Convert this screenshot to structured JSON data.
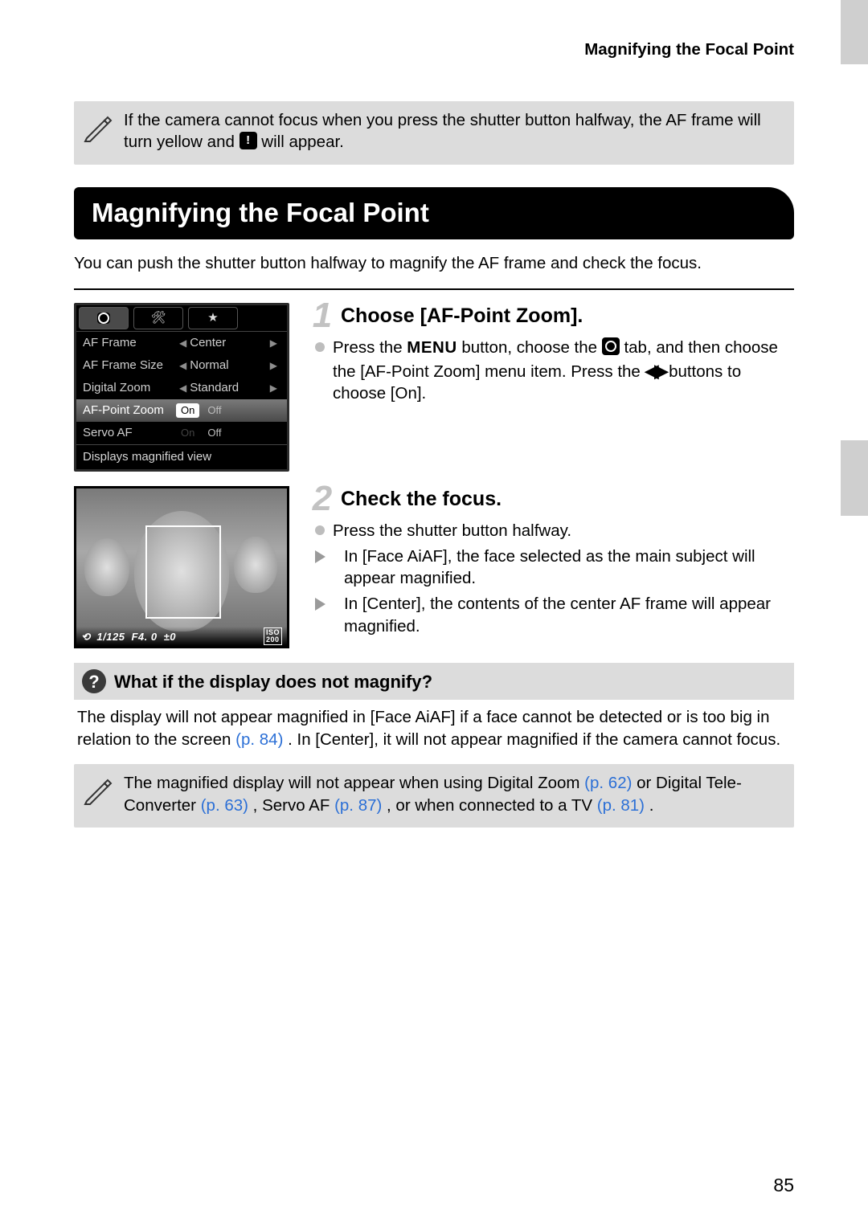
{
  "running_head": "Magnifying the Focal Point",
  "note_top": {
    "before_icon": "If the camera cannot focus when you press the shutter button halfway, the AF frame will turn yellow and ",
    "after_icon": " will appear."
  },
  "section_title": "Magnifying the Focal Point",
  "intro": "You can push the shutter button halfway to magnify the AF frame and check the focus.",
  "menu_mock": {
    "rows": {
      "af_frame": {
        "k": "AF Frame",
        "v": "Center"
      },
      "af_frame_size": {
        "k": "AF Frame Size",
        "v": "Normal"
      },
      "digital_zoom": {
        "k": "Digital Zoom",
        "v": "Standard"
      },
      "af_point_zoom": {
        "k": "AF-Point Zoom",
        "on": "On",
        "off": "Off"
      },
      "servo_af": {
        "k": "Servo AF",
        "on": "On",
        "off": "Off"
      }
    },
    "footer": "Displays magnified view"
  },
  "photo_mock": {
    "shutter": "1/125",
    "aperture": "F4. 0",
    "ev": "±0",
    "iso_top": "ISO",
    "iso_bottom": "200"
  },
  "step1": {
    "num": "1",
    "title": "Choose [AF-Point Zoom].",
    "bullet_a": "Press the ",
    "menu_word": "MENU",
    "bullet_b": " button, choose the ",
    "bullet_c": " tab, and then choose the [AF-Point Zoom] menu item. Press the ",
    "bullet_d": " buttons to choose [On]."
  },
  "step2": {
    "num": "2",
    "title": "Check the focus.",
    "line1": "Press the shutter button halfway.",
    "line2": "In [Face AiAF], the face selected as the main subject will appear magnified.",
    "line3": "In [Center], the contents of the center AF frame will appear magnified."
  },
  "question": {
    "title": "What if the display does not magnify?",
    "body_a": "The display will not appear magnified in [Face AiAF] if a face cannot be detected or is too big in relation to the screen ",
    "link_a": "(p. 84)",
    "body_b": ". In [Center], it will not appear magnified if the camera cannot focus."
  },
  "note_bottom": {
    "a": "The magnified display will not appear when using Digital Zoom ",
    "l1": "(p. 62)",
    "b": " or Digital Tele-Converter ",
    "l2": "(p. 63)",
    "c": ", Servo AF ",
    "l3": "(p. 87)",
    "d": ", or when connected to a TV ",
    "l4": "(p. 81)",
    "e": "."
  },
  "page_number": "85"
}
